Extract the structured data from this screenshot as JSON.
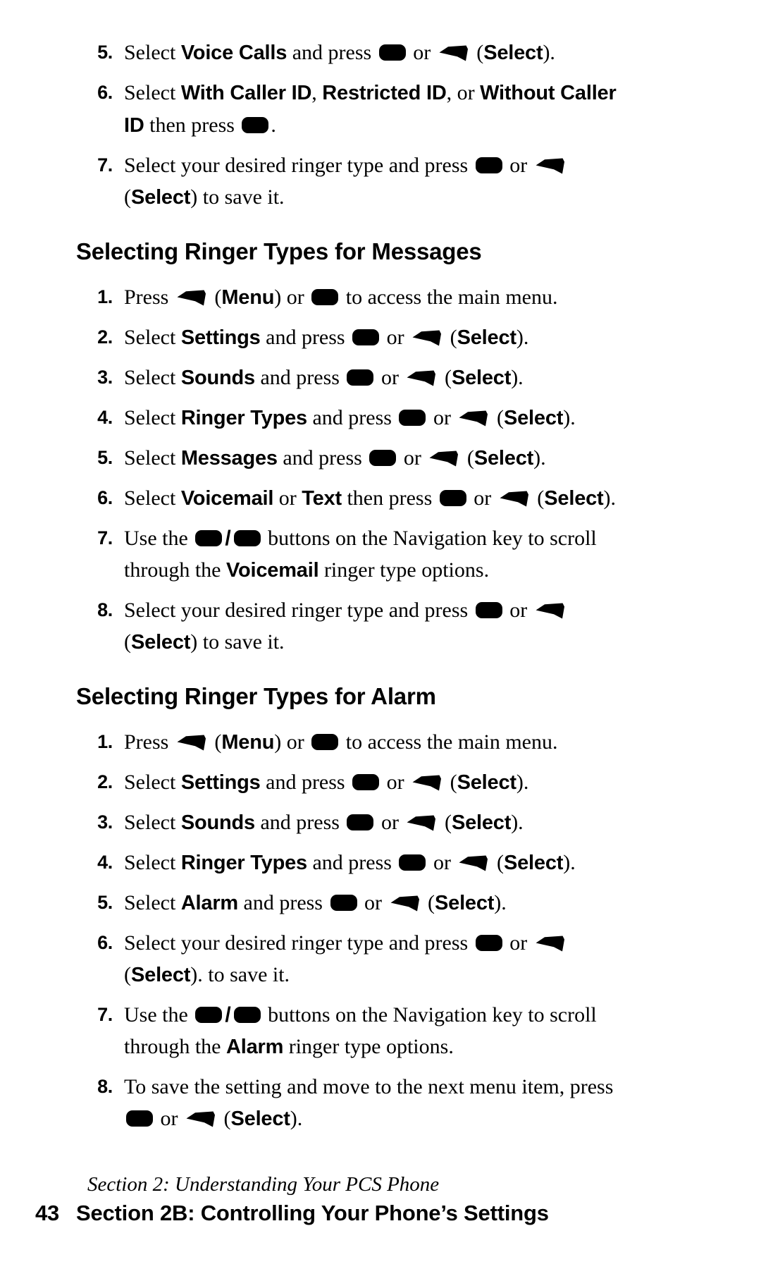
{
  "page": {
    "number": "43",
    "footer_section_italic": "Section 2: Understanding Your PCS Phone",
    "footer_section_bold": "Section 2B: Controlling Your Phone’s Settings"
  },
  "icons": {
    "ok_key": "ok-key-icon",
    "soft_key": "softkey-icon",
    "nav_up_key": "nav-up-key-icon",
    "nav_down_key": "nav-down-key-icon"
  },
  "colors": {
    "text": "#000000",
    "background": "#ffffff",
    "icon_fill": "#000000"
  },
  "continued_steps": {
    "items": [
      {
        "number": "5.",
        "parts": [
          {
            "t": "text",
            "v": "Select "
          },
          {
            "t": "bold",
            "v": "Voice Calls"
          },
          {
            "t": "text",
            "v": " and press "
          },
          {
            "t": "ok"
          },
          {
            "t": "text",
            "v": " or "
          },
          {
            "t": "soft"
          },
          {
            "t": "text",
            "v": " ("
          },
          {
            "t": "bold",
            "v": "Select"
          },
          {
            "t": "text",
            "v": ")."
          }
        ]
      },
      {
        "number": "6.",
        "parts": [
          {
            "t": "text",
            "v": "Select "
          },
          {
            "t": "bold",
            "v": "With Caller ID"
          },
          {
            "t": "text",
            "v": ", "
          },
          {
            "t": "bold",
            "v": "Restricted ID"
          },
          {
            "t": "text",
            "v": ", or "
          },
          {
            "t": "bold",
            "v": "Without Caller ID"
          },
          {
            "t": "text",
            "v": " then press "
          },
          {
            "t": "ok"
          },
          {
            "t": "text",
            "v": "."
          }
        ]
      },
      {
        "number": "7.",
        "parts": [
          {
            "t": "text",
            "v": "Select your desired ringer type and press "
          },
          {
            "t": "ok"
          },
          {
            "t": "text",
            "v": " or "
          },
          {
            "t": "soft"
          },
          {
            "t": "text",
            "v": " ("
          },
          {
            "t": "bold",
            "v": "Select"
          },
          {
            "t": "text",
            "v": ") to save it."
          }
        ]
      }
    ]
  },
  "section_messages": {
    "heading": "Selecting Ringer Types for Messages",
    "items": [
      {
        "number": "1.",
        "parts": [
          {
            "t": "text",
            "v": "Press "
          },
          {
            "t": "soft"
          },
          {
            "t": "text",
            "v": " ("
          },
          {
            "t": "bold",
            "v": "Menu"
          },
          {
            "t": "text",
            "v": ") or "
          },
          {
            "t": "ok"
          },
          {
            "t": "text",
            "v": " to access the main menu."
          }
        ]
      },
      {
        "number": "2.",
        "parts": [
          {
            "t": "text",
            "v": "Select "
          },
          {
            "t": "bold",
            "v": "Settings"
          },
          {
            "t": "text",
            "v": " and press "
          },
          {
            "t": "ok"
          },
          {
            "t": "text",
            "v": " or "
          },
          {
            "t": "soft"
          },
          {
            "t": "text",
            "v": " ("
          },
          {
            "t": "bold",
            "v": "Select"
          },
          {
            "t": "text",
            "v": ")."
          }
        ]
      },
      {
        "number": "3.",
        "parts": [
          {
            "t": "text",
            "v": "Select "
          },
          {
            "t": "bold",
            "v": "Sounds"
          },
          {
            "t": "text",
            "v": " and press "
          },
          {
            "t": "ok"
          },
          {
            "t": "text",
            "v": " or "
          },
          {
            "t": "soft"
          },
          {
            "t": "text",
            "v": " ("
          },
          {
            "t": "bold",
            "v": "Select"
          },
          {
            "t": "text",
            "v": ")."
          }
        ]
      },
      {
        "number": "4.",
        "parts": [
          {
            "t": "text",
            "v": "Select "
          },
          {
            "t": "bold",
            "v": "Ringer Types"
          },
          {
            "t": "text",
            "v": " and press "
          },
          {
            "t": "ok"
          },
          {
            "t": "text",
            "v": " or "
          },
          {
            "t": "soft"
          },
          {
            "t": "text",
            "v": " ("
          },
          {
            "t": "bold",
            "v": "Select"
          },
          {
            "t": "text",
            "v": ")."
          }
        ]
      },
      {
        "number": "5.",
        "parts": [
          {
            "t": "text",
            "v": "Select "
          },
          {
            "t": "bold",
            "v": "Messages"
          },
          {
            "t": "text",
            "v": " and press "
          },
          {
            "t": "ok"
          },
          {
            "t": "text",
            "v": " or "
          },
          {
            "t": "soft"
          },
          {
            "t": "text",
            "v": " ("
          },
          {
            "t": "bold",
            "v": "Select"
          },
          {
            "t": "text",
            "v": ")."
          }
        ]
      },
      {
        "number": "6.",
        "parts": [
          {
            "t": "text",
            "v": "Select "
          },
          {
            "t": "bold",
            "v": "Voicemail"
          },
          {
            "t": "text",
            "v": " or "
          },
          {
            "t": "bold",
            "v": "Text"
          },
          {
            "t": "text",
            "v": " then press "
          },
          {
            "t": "ok"
          },
          {
            "t": "text",
            "v": " or "
          },
          {
            "t": "soft"
          },
          {
            "t": "text",
            "v": " ("
          },
          {
            "t": "bold",
            "v": "Select"
          },
          {
            "t": "text",
            "v": ")."
          }
        ]
      },
      {
        "number": "7.",
        "parts": [
          {
            "t": "text",
            "v": "Use the "
          },
          {
            "t": "ok"
          },
          {
            "t": "slash",
            "v": "/"
          },
          {
            "t": "ok"
          },
          {
            "t": "text",
            "v": " buttons on the Navigation key to scroll through the "
          },
          {
            "t": "bold",
            "v": "Voicemail"
          },
          {
            "t": "text",
            "v": " ringer type options."
          }
        ]
      },
      {
        "number": "8.",
        "parts": [
          {
            "t": "text",
            "v": "Select your desired ringer type and press "
          },
          {
            "t": "ok"
          },
          {
            "t": "text",
            "v": " or "
          },
          {
            "t": "soft"
          },
          {
            "t": "text",
            "v": " ("
          },
          {
            "t": "bold",
            "v": "Select"
          },
          {
            "t": "text",
            "v": ") to save it."
          }
        ]
      }
    ]
  },
  "section_alarm": {
    "heading": "Selecting Ringer Types for Alarm",
    "items": [
      {
        "number": "1.",
        "parts": [
          {
            "t": "text",
            "v": "Press "
          },
          {
            "t": "soft"
          },
          {
            "t": "text",
            "v": " ("
          },
          {
            "t": "bold",
            "v": "Menu"
          },
          {
            "t": "text",
            "v": ") or "
          },
          {
            "t": "ok"
          },
          {
            "t": "text",
            "v": " to access the main menu."
          }
        ]
      },
      {
        "number": "2.",
        "parts": [
          {
            "t": "text",
            "v": "Select "
          },
          {
            "t": "bold",
            "v": "Settings"
          },
          {
            "t": "text",
            "v": " and press "
          },
          {
            "t": "ok"
          },
          {
            "t": "text",
            "v": " or "
          },
          {
            "t": "soft"
          },
          {
            "t": "text",
            "v": " ("
          },
          {
            "t": "bold",
            "v": "Select"
          },
          {
            "t": "text",
            "v": ")."
          }
        ]
      },
      {
        "number": "3.",
        "parts": [
          {
            "t": "text",
            "v": "Select "
          },
          {
            "t": "bold",
            "v": "Sounds"
          },
          {
            "t": "text",
            "v": " and press "
          },
          {
            "t": "ok"
          },
          {
            "t": "text",
            "v": " or "
          },
          {
            "t": "soft"
          },
          {
            "t": "text",
            "v": " ("
          },
          {
            "t": "bold",
            "v": "Select"
          },
          {
            "t": "text",
            "v": ")."
          }
        ]
      },
      {
        "number": "4.",
        "parts": [
          {
            "t": "text",
            "v": "Select "
          },
          {
            "t": "bold",
            "v": "Ringer Types"
          },
          {
            "t": "text",
            "v": " and press "
          },
          {
            "t": "ok"
          },
          {
            "t": "text",
            "v": " or "
          },
          {
            "t": "soft"
          },
          {
            "t": "text",
            "v": " ("
          },
          {
            "t": "bold",
            "v": "Select"
          },
          {
            "t": "text",
            "v": ")."
          }
        ]
      },
      {
        "number": "5.",
        "parts": [
          {
            "t": "text",
            "v": "Select "
          },
          {
            "t": "bold",
            "v": "Alarm"
          },
          {
            "t": "text",
            "v": " and press "
          },
          {
            "t": "ok"
          },
          {
            "t": "text",
            "v": " or "
          },
          {
            "t": "soft"
          },
          {
            "t": "text",
            "v": " ("
          },
          {
            "t": "bold",
            "v": "Select"
          },
          {
            "t": "text",
            "v": ")."
          }
        ]
      },
      {
        "number": "6.",
        "parts": [
          {
            "t": "text",
            "v": "Select your desired ringer type and press "
          },
          {
            "t": "ok"
          },
          {
            "t": "text",
            "v": " or "
          },
          {
            "t": "soft"
          },
          {
            "t": "text",
            "v": " ("
          },
          {
            "t": "bold",
            "v": "Select"
          },
          {
            "t": "text",
            "v": "). to save it."
          }
        ]
      },
      {
        "number": "7.",
        "parts": [
          {
            "t": "text",
            "v": "Use the "
          },
          {
            "t": "ok"
          },
          {
            "t": "slash",
            "v": "/"
          },
          {
            "t": "ok"
          },
          {
            "t": "text",
            "v": " buttons on the Navigation key to scroll through the "
          },
          {
            "t": "bold",
            "v": "Alarm"
          },
          {
            "t": "text",
            "v": " ringer type options."
          }
        ]
      },
      {
        "number": "8.",
        "parts": [
          {
            "t": "text",
            "v": "To save the setting and move to the next menu item, press "
          },
          {
            "t": "ok"
          },
          {
            "t": "text",
            "v": " or "
          },
          {
            "t": "soft"
          },
          {
            "t": "text",
            "v": " ("
          },
          {
            "t": "bold",
            "v": "Select"
          },
          {
            "t": "text",
            "v": ")."
          }
        ]
      }
    ]
  }
}
